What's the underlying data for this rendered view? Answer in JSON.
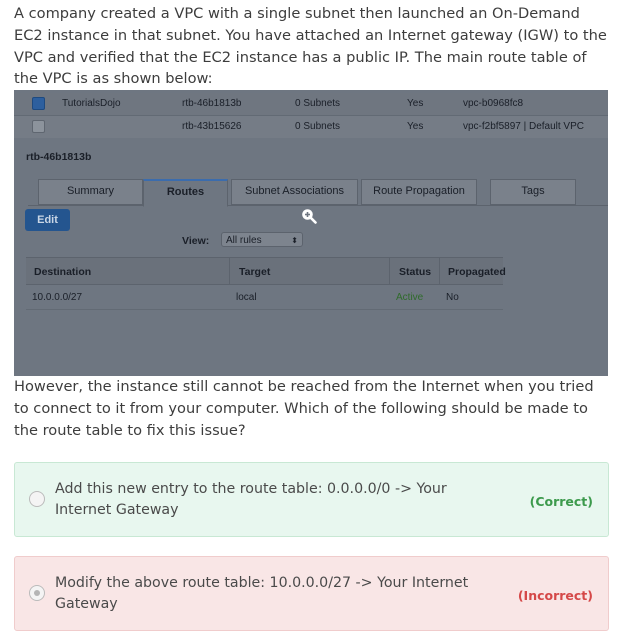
{
  "question": {
    "intro": "A company created a VPC with a single subnet then launched an On-Demand EC2 instance in that subnet. You have attached an Internet gateway (IGW) to the VPC and verified that the EC2 instance has a public IP. The main route table of the VPC is as shown below:",
    "followup": "However, the instance still cannot be reached from the Internet when you tried to connect to it from your computer. Which of the following should be made to the route table to fix this issue?"
  },
  "screenshot": {
    "route_tables": [
      {
        "name": "TutorialsDojo",
        "id": "rtb-46b1813b",
        "subnets": "0 Subnets",
        "main": "Yes",
        "vpc": "vpc-b0968fc8",
        "checked": true
      },
      {
        "name": "",
        "id": "rtb-43b15626",
        "subnets": "0 Subnets",
        "main": "Yes",
        "vpc": "vpc-f2bf5897 | Default VPC",
        "checked": false
      }
    ],
    "selected_id": "rtb-46b1813b",
    "tabs": [
      "Summary",
      "Routes",
      "Subnet Associations",
      "Route Propagation",
      "Tags"
    ],
    "active_tab": "Routes",
    "edit_label": "Edit",
    "view_label": "View:",
    "view_value": "All rules",
    "columns": [
      "Destination",
      "Target",
      "Status",
      "Propagated"
    ],
    "routes": [
      {
        "destination": "10.0.0.0/27",
        "target": "local",
        "status": "Active",
        "propagated": "No"
      }
    ],
    "colors": {
      "active_status": "#2f6b2b",
      "edit_button": "#24558f"
    }
  },
  "answers": [
    {
      "text": "Add this new entry to the route table: 0.0.0.0/0 -> Your Internet Gateway",
      "verdict": "(Correct)",
      "selected": false
    },
    {
      "text": "Modify the above route table: 10.0.0.0/27 -> Your Internet Gateway",
      "verdict": "(Incorrect)",
      "selected": true
    }
  ],
  "colors": {
    "correct": "#3c9a4c",
    "incorrect": "#d54848",
    "correct_bg": "#e8f7ef",
    "incorrect_bg": "#f9e6e6"
  }
}
